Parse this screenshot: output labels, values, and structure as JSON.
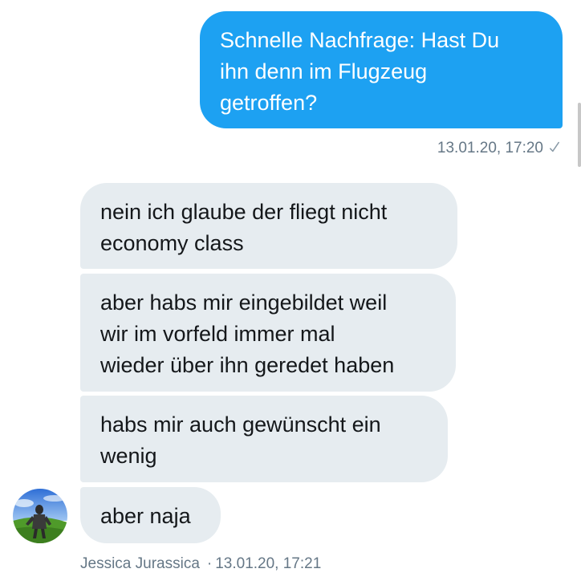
{
  "conversation": {
    "sent_messages": [
      {
        "text": "Schnelle Nachfrage: Hast Du\nihn denn im Flugzeug\ngetroffen?",
        "timestamp": "13.01.20, 17:20",
        "status_icon": "check-icon"
      }
    ],
    "received_messages": [
      {
        "text": "nein ich glaube der fliegt nicht\neconomy class"
      },
      {
        "text": "aber habs mir eingebildet weil\nwir im vorfeld immer mal\nwieder über ihn geredet haben"
      },
      {
        "text": "habs mir auch gewünscht ein\nwenig"
      },
      {
        "text": "aber naja"
      }
    ],
    "received_meta": {
      "sender_name": "Jessica Jurassica",
      "separator": "·",
      "timestamp": "13.01.20, 17:21"
    }
  },
  "colors": {
    "sent_bubble": "#1da1f2",
    "received_bubble": "#e6ecf0",
    "meta_text": "#657786"
  }
}
